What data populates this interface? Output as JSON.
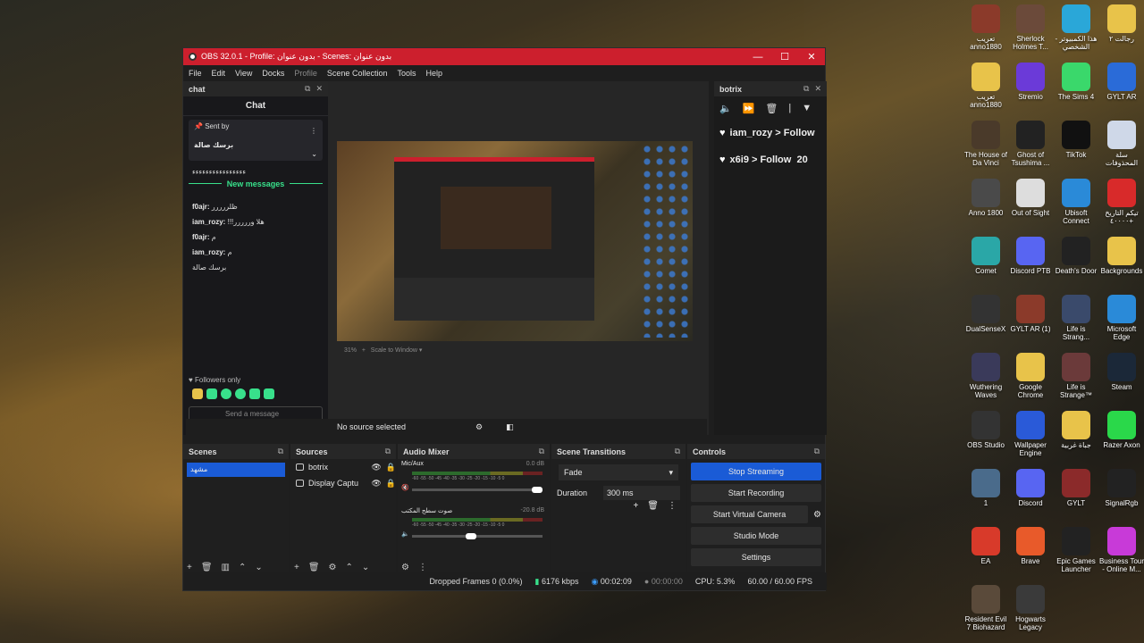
{
  "window": {
    "title": "OBS 32.0.1 - Profile: بدون عنوان - Scenes: بدون عنوان",
    "controls": [
      "—",
      "☐",
      "✕"
    ]
  },
  "menu": [
    "File",
    "Edit",
    "View",
    "Docks",
    "Profile",
    "Scene Collection",
    "Tools",
    "Help"
  ],
  "chat_dock": {
    "dock_title": "chat",
    "header": "Chat",
    "pinned_label": "Sent by",
    "pinned_text": "برسك صالة",
    "first_line": "ءءءءءءءءءءءءءءءء",
    "new_messages": "New messages",
    "messages": [
      {
        "user": "f0ajr:",
        "text": "ظلررررر"
      },
      {
        "user": "iam_rozy:",
        "text": "!!!هلا وررررر"
      },
      {
        "user": "f0ajr:",
        "text": "م"
      },
      {
        "user": "iam_rozy:",
        "text": "م"
      },
      {
        "user": "",
        "text": "برسك صالة"
      }
    ],
    "followers_only": "Followers only",
    "send_placeholder": "Send a message"
  },
  "preview": {
    "zoom": "31%",
    "scale_mode": "Scale to Window",
    "no_source": "No source selected"
  },
  "botrix_dock": {
    "dock_title": "botrix",
    "alerts": [
      {
        "user": "iam_rozy",
        "action": "Follow"
      },
      {
        "user": "x6i9",
        "action": "Follow",
        "extra": "20"
      }
    ]
  },
  "scenes": {
    "title": "Scenes",
    "items": [
      "مشهد"
    ]
  },
  "sources": {
    "title": "Sources",
    "items": [
      "botrix",
      "Display Captu"
    ]
  },
  "audio_mixer": {
    "title": "Audio Mixer",
    "tracks": [
      {
        "name": "Mic/Aux",
        "db": "0.0 dB"
      },
      {
        "name": "صوت سطح المكتب",
        "db": "-20.8 dB"
      }
    ],
    "scale": "-60 -55 -50 -45 -40 -35 -30 -25 -20 -15 -10 -5 0"
  },
  "transitions": {
    "title": "Scene Transitions",
    "selected": "Fade",
    "duration_label": "Duration",
    "duration_value": "300 ms"
  },
  "controls": {
    "title": "Controls",
    "buttons": [
      "Stop Streaming",
      "Start Recording",
      "Start Virtual Camera",
      "Studio Mode",
      "Settings"
    ]
  },
  "status": {
    "dropped": "Dropped Frames 0 (0.0%)",
    "bitrate": "6176 kbps",
    "stream_time": "00:02:09",
    "rec_time": "00:00:00",
    "cpu": "CPU: 5.3%",
    "fps": "60.00 / 60.00 FPS"
  },
  "desktop_icons": [
    {
      "label": "تعريب anno1880",
      "color": "#8b3a2a"
    },
    {
      "label": "Sherlock Holmes T...",
      "color": "#6b4a3a"
    },
    {
      "label": "هذا الكمبيوتر - الشخصي",
      "color": "#2aa7d8"
    },
    {
      "label": "رجالت ٢",
      "color": "#e8c34a"
    },
    {
      "label": "تعريب anno1880",
      "color": "#e8c34a"
    },
    {
      "label": "Stremio",
      "color": "#6b3ad8"
    },
    {
      "label": "The Sims 4",
      "color": "#3ad86b"
    },
    {
      "label": "GYLT AR",
      "color": "#2a6bd8"
    },
    {
      "label": "The House of Da Vinci",
      "color": "#4a3a2a"
    },
    {
      "label": "Ghost of Tsushima ...",
      "color": "#222222"
    },
    {
      "label": "TikTok",
      "color": "#111111"
    },
    {
      "label": "سلة المحذوفات",
      "color": "#cfd8e8"
    },
    {
      "label": "Anno 1800",
      "color": "#4a4a4a"
    },
    {
      "label": "Out of Sight",
      "color": "#dddddd"
    },
    {
      "label": "Ubisoft Connect",
      "color": "#2a8ad8"
    },
    {
      "label": "تيكم التاريخ ٤٠٠٠٠+",
      "color": "#d82a2a"
    },
    {
      "label": "Comet",
      "color": "#2aa7a7"
    },
    {
      "label": "Discord PTB",
      "color": "#5865f2"
    },
    {
      "label": "Death's Door",
      "color": "#222222"
    },
    {
      "label": "Backgrounds",
      "color": "#e8c34a"
    },
    {
      "label": "DualSenseX",
      "color": "#333333"
    },
    {
      "label": "GYLT AR (1)",
      "color": "#8b3a2a"
    },
    {
      "label": "Life is Strang...",
      "color": "#3a4a6b"
    },
    {
      "label": "Microsoft Edge",
      "color": "#2a8ad8"
    },
    {
      "label": "Wuthering Waves",
      "color": "#3a3a5a"
    },
    {
      "label": "Google Chrome",
      "color": "#e8c34a"
    },
    {
      "label": "Life is Strange™",
      "color": "#6b3a3a"
    },
    {
      "label": "Steam",
      "color": "#1b2838"
    },
    {
      "label": "OBS Studio",
      "color": "#333333"
    },
    {
      "label": "Wallpaper Engine",
      "color": "#2a5ad8"
    },
    {
      "label": "جباة غربية",
      "color": "#e8c34a"
    },
    {
      "label": "Razer Axon",
      "color": "#2ad84a"
    },
    {
      "label": "1",
      "color": "#4a6b8b"
    },
    {
      "label": "Discord",
      "color": "#5865f2"
    },
    {
      "label": "GYLT",
      "color": "#8b2a2a"
    },
    {
      "label": "SignalRgb",
      "color": "#222222"
    },
    {
      "label": "EA",
      "color": "#d83a2a"
    },
    {
      "label": "Brave",
      "color": "#e85a2a"
    },
    {
      "label": "Epic Games Launcher",
      "color": "#222222"
    },
    {
      "label": "Business Tour - Online M...",
      "color": "#c83ad8"
    },
    {
      "label": "Resident Evil 7 Biohazard",
      "color": "#5a4a3a"
    },
    {
      "label": "Hogwarts Legacy",
      "color": "#3a3a3a"
    }
  ]
}
